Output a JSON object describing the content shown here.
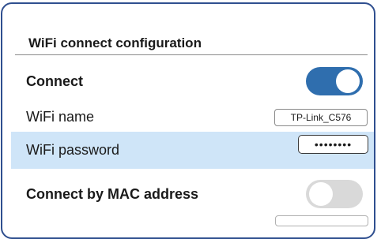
{
  "panel": {
    "title": "WiFi connect configuration"
  },
  "settings": {
    "connect": {
      "label": "Connect",
      "enabled": true
    },
    "wifi_name": {
      "label": "WiFi name",
      "value": "TP-Link_C576"
    },
    "wifi_password": {
      "label": "WiFi password",
      "value": "••••••••"
    },
    "connect_by_mac": {
      "label": "Connect by MAC address",
      "enabled": false
    }
  },
  "colors": {
    "frame_border": "#2f4f8f",
    "toggle_on": "#2f6eae",
    "toggle_off": "#d9d9d9",
    "highlight_row": "#cfe5f8"
  }
}
